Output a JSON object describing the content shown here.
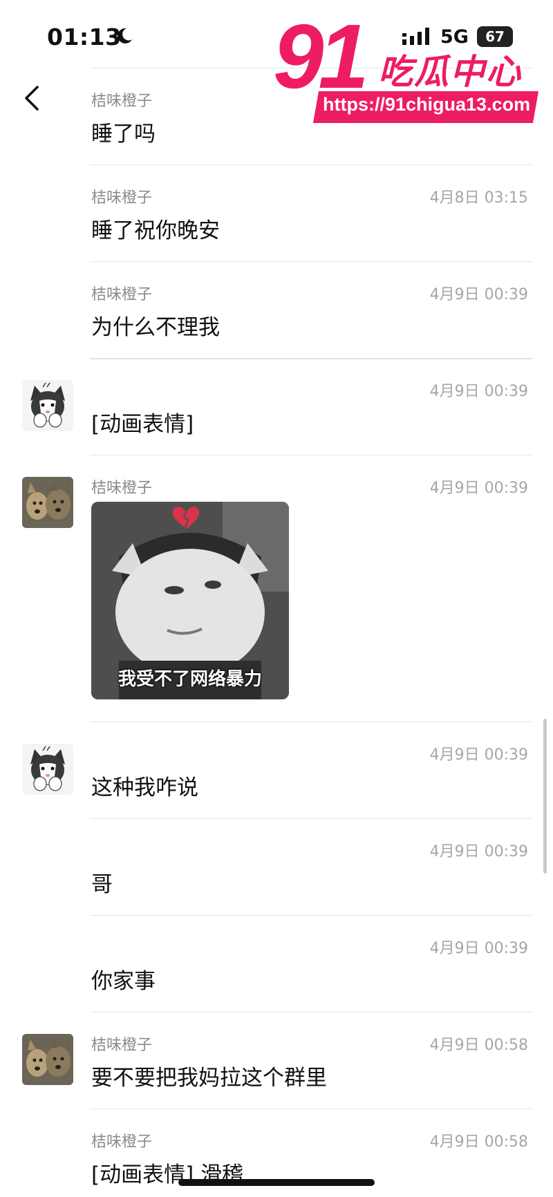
{
  "status": {
    "time": "01:13",
    "network": "5G",
    "battery": "67",
    "icons": [
      "moon-icon",
      "signal-icon"
    ]
  },
  "watermark": {
    "number": "91",
    "title": "吃瓜中心",
    "url": "https://91chigua13.com",
    "color": "#ee1c64"
  },
  "nav": {
    "back_icon": "chevron-left-icon"
  },
  "messages": [
    {
      "sender": "桔味橙子",
      "time": "",
      "text": "睡了吗",
      "avatar": ""
    },
    {
      "sender": "桔味橙子",
      "time": "4月8日 03:15",
      "text": "睡了祝你晚安",
      "avatar": ""
    },
    {
      "sender": "桔味橙子",
      "time": "4月9日 00:39",
      "text": "为什么不理我",
      "avatar": ""
    },
    {
      "sender": "",
      "time": "4月9日 00:39",
      "text": "[动画表情]",
      "avatar": "cat-avatar"
    },
    {
      "sender": "桔味橙子",
      "time": "4月9日 00:39",
      "text": "",
      "avatar": "dog-avatar",
      "sticker_caption": "我受不了网络暴力"
    },
    {
      "sender": "",
      "time": "4月9日 00:39",
      "text": "这种我咋说",
      "avatar": "cat-avatar"
    },
    {
      "sender": "",
      "time": "4月9日 00:39",
      "text": "哥",
      "avatar": ""
    },
    {
      "sender": "",
      "time": "4月9日 00:39",
      "text": "你家事",
      "avatar": ""
    },
    {
      "sender": "桔味橙子",
      "time": "4月9日 00:58",
      "text": "要不要把我妈拉这个群里",
      "avatar": "dog-avatar"
    },
    {
      "sender": "桔味橙子",
      "time": "4月9日 00:58",
      "text": "[动画表情] 滑稽",
      "avatar": ""
    }
  ]
}
